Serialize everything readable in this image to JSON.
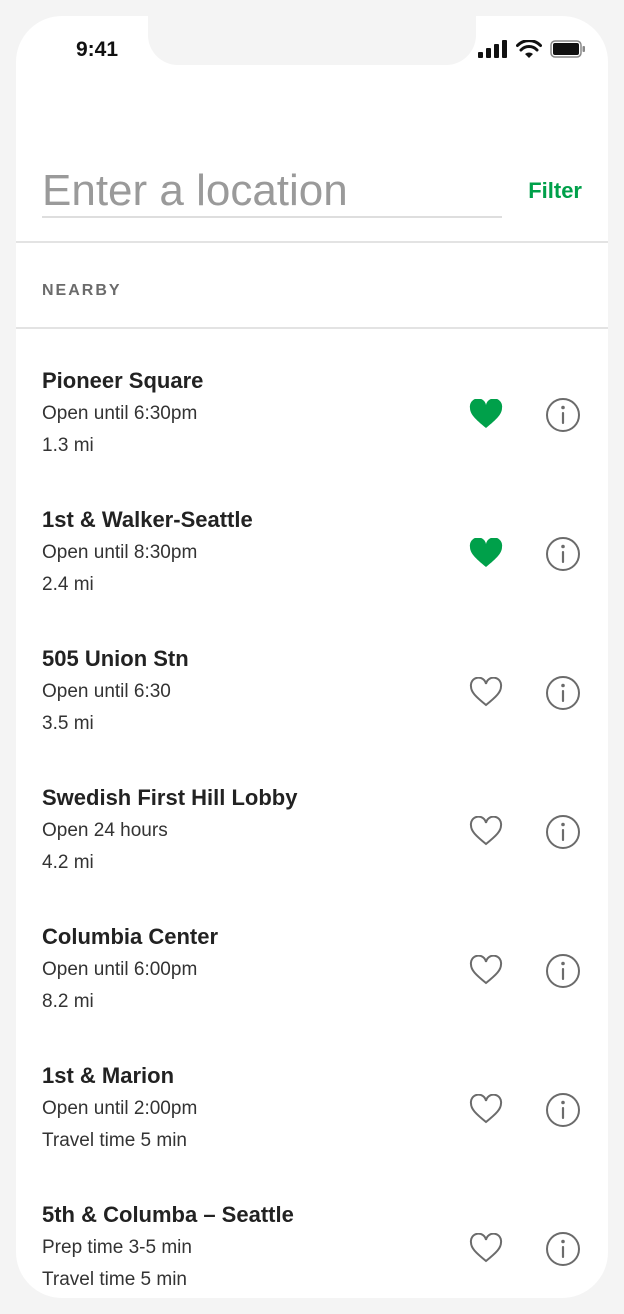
{
  "status_bar": {
    "time": "9:41"
  },
  "search": {
    "placeholder": "Enter a location",
    "filter_label": "Filter"
  },
  "section": {
    "label": "NEARBY"
  },
  "colors": {
    "accent": "#00a04a",
    "icon_gray": "#6b6b6b"
  },
  "stores": [
    {
      "name": "Pioneer Square",
      "line1": "Open until 6:30pm",
      "line2": "1.3 mi",
      "favorite": true
    },
    {
      "name": "1st & Walker-Seattle",
      "line1": "Open until 8:30pm",
      "line2": "2.4 mi",
      "favorite": true
    },
    {
      "name": "505 Union Stn",
      "line1": "Open until 6:30",
      "line2": "3.5 mi",
      "favorite": false
    },
    {
      "name": "Swedish First Hill Lobby",
      "line1": "Open 24 hours",
      "line2": "4.2 mi",
      "favorite": false
    },
    {
      "name": "Columbia Center",
      "line1": "Open until 6:00pm",
      "line2": "8.2 mi",
      "favorite": false
    },
    {
      "name": "1st & Marion",
      "line1": "Open until 2:00pm",
      "line2": "Travel time 5 min",
      "favorite": false
    },
    {
      "name": "5th & Columba – Seattle",
      "line1": "Prep time 3-5 min",
      "line2": "Travel time 5 min",
      "favorite": false
    }
  ]
}
